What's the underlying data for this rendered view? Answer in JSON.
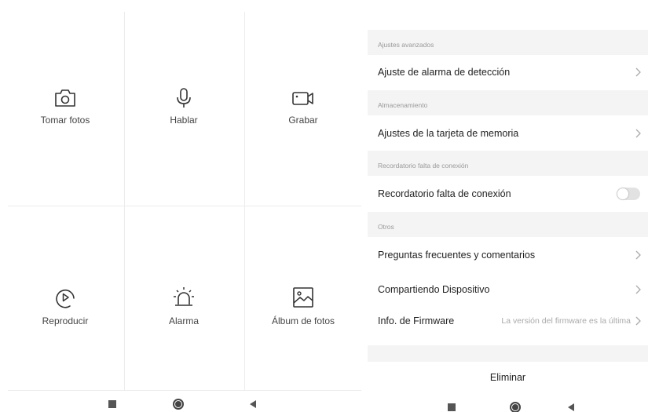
{
  "left_panel": {
    "actions": [
      {
        "label": "Tomar fotos",
        "icon": "camera-icon"
      },
      {
        "label": "Hablar",
        "icon": "microphone-icon"
      },
      {
        "label": "Grabar",
        "icon": "video-camera-icon"
      },
      {
        "label": "Reproducir",
        "icon": "playback-icon"
      },
      {
        "label": "Alarma",
        "icon": "alarm-siren-icon"
      },
      {
        "label": "Álbum de fotos",
        "icon": "photo-album-icon"
      }
    ]
  },
  "right_panel": {
    "sections": [
      {
        "header": "Ajustes avanzados",
        "rows": [
          {
            "label": "Ajuste de alarma de detección",
            "control": "chevron"
          }
        ]
      },
      {
        "header": "Almacenamiento",
        "rows": [
          {
            "label": "Ajustes de la tarjeta de memoria",
            "control": "chevron"
          }
        ]
      },
      {
        "header": "Recordatorio falta de conexión",
        "rows": [
          {
            "label": "Recordatorio falta de conexión",
            "control": "toggle",
            "toggle_on": false
          }
        ]
      },
      {
        "header": "Otros",
        "rows": [
          {
            "label": "Preguntas frecuentes y comentarios",
            "control": "chevron"
          },
          {
            "label": "Compartiendo Dispositivo",
            "control": "chevron"
          },
          {
            "label": "Info. de Firmware",
            "value": "La versión del firmware es la última",
            "control": "chevron"
          }
        ]
      }
    ],
    "delete_label": "Eliminar"
  },
  "colors": {
    "section_background": "#f4f4f4",
    "divider": "#ececec",
    "icon_stroke": "#333333",
    "toggle_off": "#e2e2e2"
  }
}
